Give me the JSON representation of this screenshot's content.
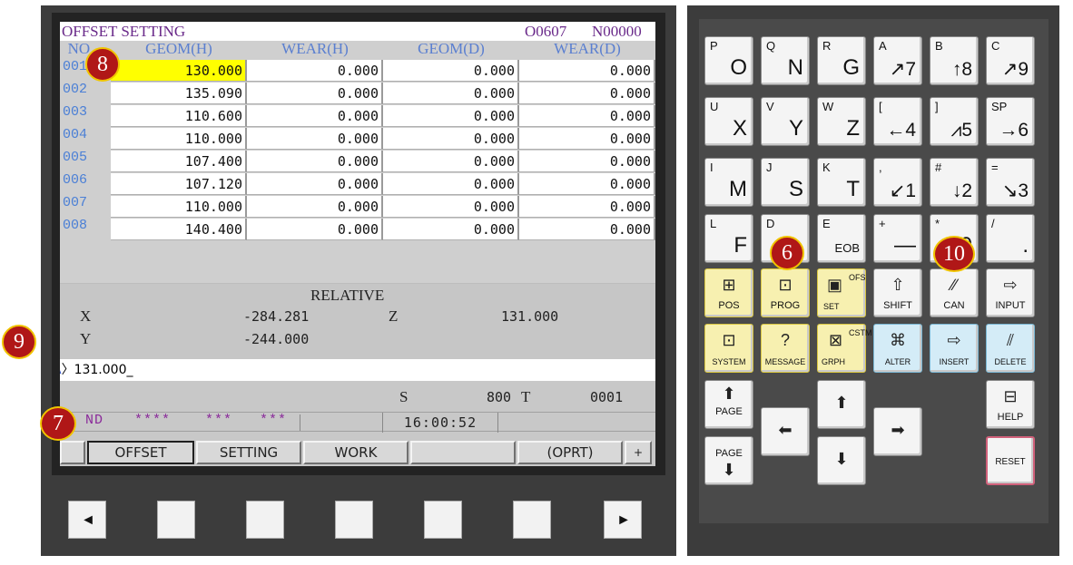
{
  "screen": {
    "title": "OFFSET SETTING",
    "program": "O0607",
    "sequence": "N00000",
    "columns": [
      "NO.",
      "GEOM(H)",
      "WEAR(H)",
      "GEOM(D)",
      "WEAR(D)"
    ],
    "rows": [
      {
        "no": "001",
        "geom_h": "130.000",
        "wear_h": "0.000",
        "geom_d": "0.000",
        "wear_d": "0.000"
      },
      {
        "no": "002",
        "geom_h": "135.090",
        "wear_h": "0.000",
        "geom_d": "0.000",
        "wear_d": "0.000"
      },
      {
        "no": "003",
        "geom_h": "110.600",
        "wear_h": "0.000",
        "geom_d": "0.000",
        "wear_d": "0.000"
      },
      {
        "no": "004",
        "geom_h": "110.000",
        "wear_h": "0.000",
        "geom_d": "0.000",
        "wear_d": "0.000"
      },
      {
        "no": "005",
        "geom_h": "107.400",
        "wear_h": "0.000",
        "geom_d": "0.000",
        "wear_d": "0.000"
      },
      {
        "no": "006",
        "geom_h": "107.120",
        "wear_h": "0.000",
        "geom_d": "0.000",
        "wear_d": "0.000"
      },
      {
        "no": "007",
        "geom_h": "110.000",
        "wear_h": "0.000",
        "geom_d": "0.000",
        "wear_d": "0.000"
      },
      {
        "no": "008",
        "geom_h": "140.400",
        "wear_h": "0.000",
        "geom_d": "0.000",
        "wear_d": "0.000"
      }
    ],
    "relative": {
      "title": "RELATIVE",
      "x_label": "X",
      "x_value": "-284.281",
      "z_label": "Z",
      "z_value": "131.000",
      "y_label": "Y",
      "y_value": "-244.000"
    },
    "input": {
      "prefix": "A",
      "text": "〉131.000_"
    },
    "status": {
      "s_label": "S",
      "s_value": "800",
      "t_label": "T",
      "t_value": "0001",
      "mode": "ND",
      "m1": "****",
      "m2": "***",
      "m3": "***",
      "clock": "16:00:52"
    },
    "softkeys": [
      "OFFSET",
      "SETTING",
      "WORK",
      "",
      "(OPRT)",
      "+"
    ]
  },
  "bottom_buttons": [
    "left-arrow",
    "blank",
    "blank",
    "blank",
    "blank",
    "blank",
    "right-arrow"
  ],
  "bottom_glyphs": {
    "left": "◄",
    "right": "►"
  },
  "keypad": {
    "row1": [
      {
        "sub": "P",
        "main": "O"
      },
      {
        "sub": "Q",
        "main": "N"
      },
      {
        "sub": "R",
        "main": "G"
      },
      {
        "sub": "A",
        "main": "↗7"
      },
      {
        "sub": "B",
        "main": "↑8"
      },
      {
        "sub": "C",
        "main": "↗9"
      }
    ],
    "row2": [
      {
        "sub": "U",
        "main": "X"
      },
      {
        "sub": "V",
        "main": "Y"
      },
      {
        "sub": "W",
        "main": "Z"
      },
      {
        "sub": "[",
        "main": "←4"
      },
      {
        "sub": "]",
        "main": "⩘5"
      },
      {
        "sub": "SP",
        "main": "→6"
      }
    ],
    "row3": [
      {
        "sub": "I",
        "main": "M"
      },
      {
        "sub": "J",
        "main": "S"
      },
      {
        "sub": "K",
        "main": "T"
      },
      {
        "sub": ",",
        "main": "↙1"
      },
      {
        "sub": "#",
        "main": "↓2"
      },
      {
        "sub": "=",
        "main": "↘3"
      }
    ],
    "row4": [
      {
        "sub": "L",
        "main": "F"
      },
      {
        "sub": "D",
        "main": "-"
      },
      {
        "sub": "E",
        "main": "EOB"
      },
      {
        "sub": "+",
        "main": "—"
      },
      {
        "sub": "*",
        "main": "0"
      },
      {
        "sub": "/",
        "main": "."
      }
    ],
    "func1": [
      "POS",
      "PROG",
      "SET",
      "SHIFT",
      "CAN",
      "INPUT"
    ],
    "func1_extra": {
      "ofs": "OFS"
    },
    "func2": [
      "SYSTEM",
      "MESSAGE",
      "GRPH",
      "ALTER",
      "INSERT",
      "DELETE"
    ],
    "func2_extra": {
      "cstm": "CSTM"
    },
    "page_up": "PAGE",
    "page_down": "PAGE",
    "help": "HELP",
    "reset": "RESET",
    "glyphs": {
      "up": "⬆",
      "down": "⬇",
      "left": "⬅",
      "right": "➡",
      "shift": "⇧"
    }
  },
  "badges": {
    "b6": "6",
    "b7": "7",
    "b8": "8",
    "b9": "9",
    "b10": "10"
  },
  "colors": {
    "highlight": "#ffff00",
    "badge_fill": "#b01717",
    "badge_ring": "#f0c400",
    "yellow_key": "#f7f0b0",
    "blue_key": "#d4ecf7"
  }
}
